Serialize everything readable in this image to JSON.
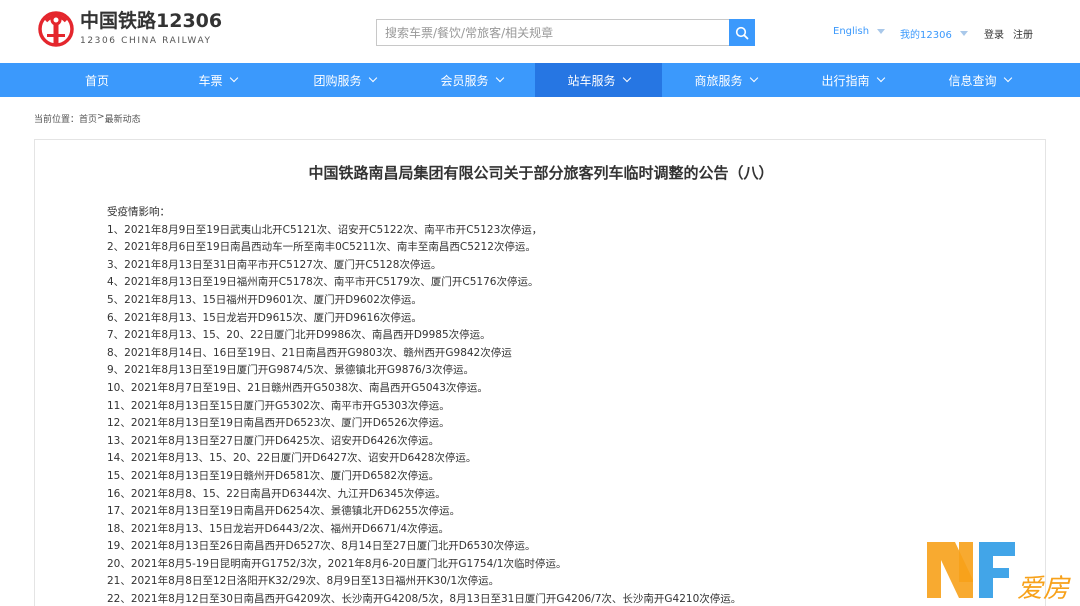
{
  "header": {
    "brand_cn": "中国铁路12306",
    "brand_en": "12306 CHINA RAILWAY",
    "search_placeholder": "搜索车票/餐饮/常旅客/相关规章",
    "english_label": "English",
    "my_label": "我的12306",
    "login_label": "登录",
    "register_label": "注册"
  },
  "nav": {
    "items": [
      {
        "label": "首页"
      },
      {
        "label": "车票"
      },
      {
        "label": "团购服务"
      },
      {
        "label": "会员服务"
      },
      {
        "label": "站车服务"
      },
      {
        "label": "商旅服务"
      },
      {
        "label": "出行指南"
      },
      {
        "label": "信息查询"
      }
    ],
    "active_index": 4
  },
  "breadcrumb": {
    "prefix": "当前位置：",
    "home": "首页",
    "sep": ">",
    "current": "最新动态"
  },
  "article": {
    "title": "中国铁路南昌局集团有限公司关于部分旅客列车临时调整的公告（八）",
    "lines": [
      "受疫情影响：",
      "1、2021年8月9日至19日武夷山北开C5121次、诏安开C5122次、南平市开C5123次停运，",
      "2、2021年8月6日至19日南昌西动车一所至南丰0C5211次、南丰至南昌西C5212次停运。",
      "3、2021年8月13日至31日南平市开C5127次、厦门开C5128次停运。",
      "4、2021年8月13日至19日福州南开C5178次、南平市开C5179次、厦门开C5176次停运。",
      "5、2021年8月13、15日福州开D9601次、厦门开D9602次停运。",
      "6、2021年8月13、15日龙岩开D9615次、厦门开D9616次停运。",
      "7、2021年8月13、15、20、22日厦门北开D9986次、南昌西开D9985次停运。",
      "8、2021年8月14日、16日至19日、21日南昌西开G9803次、赣州西开G9842次停运",
      "9、2021年8月13日至19日厦门开G9874/5次、景德镇北开G9876/3次停运。",
      "10、2021年8月7日至19日、21日赣州西开G5038次、南昌西开G5043次停运。",
      "11、2021年8月13日至15日厦门开G5302次、南平市开G5303次停运。",
      "12、2021年8月13日至19日南昌西开D6523次、厦门开D6526次停运。",
      "13、2021年8月13日至27日厦门开D6425次、诏安开D6426次停运。",
      "14、2021年8月13、15、20、22日厦门开D6427次、诏安开D6428次停运。",
      "15、2021年8月13日至19日赣州开D6581次、厦门开D6582次停运。",
      "16、2021年8月8、15、22日南昌开D6344次、九江开D6345次停运。",
      "17、2021年8月13日至19日南昌开D6254次、景德镇北开D6255次停运。",
      "18、2021年8月13、15日龙岩开D6443/2次、福州开D6671/4次停运。",
      "19、2021年8月13日至26日南昌西开D6527次、8月14日至27日厦门北开D6530次停运。",
      "20、2021年8月5-19日昆明南开G1752/3次，2021年8月6-20日厦门北开G1754/1次临时停运。",
      "21、2021年8月8日至12日洛阳开K32/29次、8月9日至13日福州开K30/1次停运。",
      "22、2021年8月12日至30日南昌西开G4209次、长沙南开G4208/5次，8月13日至31日厦门开G4206/7次、长沙南开G4210次停运。"
    ]
  },
  "watermark": {
    "text": "爱房"
  },
  "colors": {
    "primary_blue": "#3b99fc",
    "nav_active": "#2676e3",
    "logo_red": "#e4262d",
    "watermark_orange": "#f7a11a",
    "watermark_blue": "#2d9be6"
  }
}
